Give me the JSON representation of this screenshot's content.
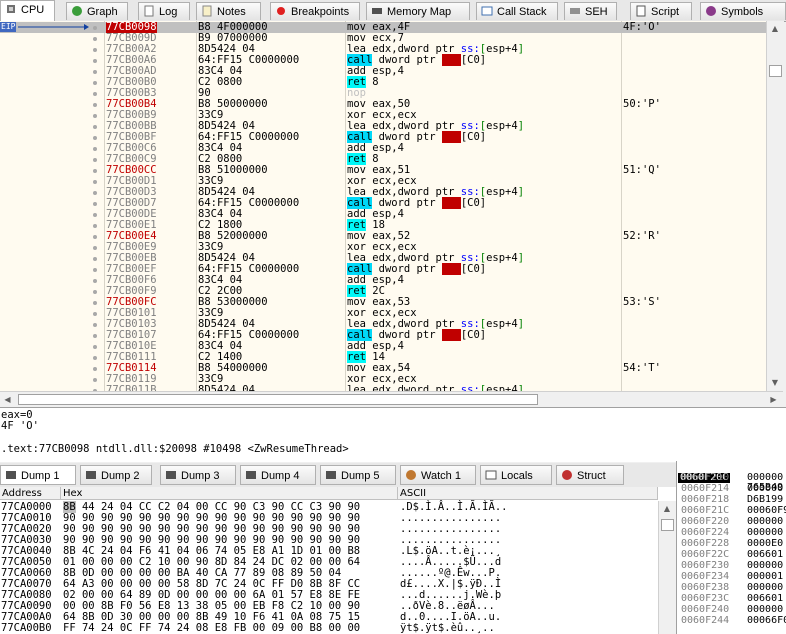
{
  "top_tabs": [
    {
      "label": "CPU",
      "icon": "cpu-icon"
    },
    {
      "label": "Graph",
      "icon": "graph-icon"
    },
    {
      "label": "Log",
      "icon": "log-icon"
    },
    {
      "label": "Notes",
      "icon": "notes-icon"
    },
    {
      "label": "Breakpoints",
      "icon": "breakpoint-icon"
    },
    {
      "label": "Memory Map",
      "icon": "memory-map-icon"
    },
    {
      "label": "Call Stack",
      "icon": "call-stack-icon"
    },
    {
      "label": "SEH",
      "icon": "seh-icon"
    },
    {
      "label": "Script",
      "icon": "script-icon"
    },
    {
      "label": "Symbols",
      "icon": "symbols-icon"
    }
  ],
  "eip_label": "EIP",
  "disasm_rows": [
    {
      "addr": "77CB0098",
      "bytes": "B8 4F000000",
      "instr": "mov eax,4F",
      "comment": "4F:'O'",
      "sel": true
    },
    {
      "addr": "77CB009D",
      "bytes": "B9 07000000",
      "instr": "mov ecx,7"
    },
    {
      "addr": "77CB00A2",
      "bytes": "8D5424 04",
      "instr": "lea edx,dword ptr ss:[esp+4]"
    },
    {
      "addr": "77CB00A6",
      "bytes": "64:FF15 C0000000",
      "instr": "call dword ptr fs:[C0]"
    },
    {
      "addr": "77CB00AD",
      "bytes": "83C4 04",
      "instr": "add esp,4"
    },
    {
      "addr": "77CB00B0",
      "bytes": "C2 0800",
      "instr": "ret 8"
    },
    {
      "addr": "77CB00B3",
      "bytes": "90",
      "instr": "nop"
    },
    {
      "addr": "77CB00B4",
      "bytes": "B8 50000000",
      "instr": "mov eax,50",
      "comment": "50:'P'",
      "red": true
    },
    {
      "addr": "77CB00B9",
      "bytes": "33C9",
      "instr": "xor ecx,ecx"
    },
    {
      "addr": "77CB00BB",
      "bytes": "8D5424 04",
      "instr": "lea edx,dword ptr ss:[esp+4]"
    },
    {
      "addr": "77CB00BF",
      "bytes": "64:FF15 C0000000",
      "instr": "call dword ptr fs:[C0]"
    },
    {
      "addr": "77CB00C6",
      "bytes": "83C4 04",
      "instr": "add esp,4"
    },
    {
      "addr": "77CB00C9",
      "bytes": "C2 0800",
      "instr": "ret 8"
    },
    {
      "addr": "77CB00CC",
      "bytes": "B8 51000000",
      "instr": "mov eax,51",
      "comment": "51:'Q'",
      "red": true
    },
    {
      "addr": "77CB00D1",
      "bytes": "33C9",
      "instr": "xor ecx,ecx"
    },
    {
      "addr": "77CB00D3",
      "bytes": "8D5424 04",
      "instr": "lea edx,dword ptr ss:[esp+4]"
    },
    {
      "addr": "77CB00D7",
      "bytes": "64:FF15 C0000000",
      "instr": "call dword ptr fs:[C0]"
    },
    {
      "addr": "77CB00DE",
      "bytes": "83C4 04",
      "instr": "add esp,4"
    },
    {
      "addr": "77CB00E1",
      "bytes": "C2 1800",
      "instr": "ret 18"
    },
    {
      "addr": "77CB00E4",
      "bytes": "B8 52000000",
      "instr": "mov eax,52",
      "comment": "52:'R'",
      "red": true
    },
    {
      "addr": "77CB00E9",
      "bytes": "33C9",
      "instr": "xor ecx,ecx"
    },
    {
      "addr": "77CB00EB",
      "bytes": "8D5424 04",
      "instr": "lea edx,dword ptr ss:[esp+4]"
    },
    {
      "addr": "77CB00EF",
      "bytes": "64:FF15 C0000000",
      "instr": "call dword ptr fs:[C0]"
    },
    {
      "addr": "77CB00F6",
      "bytes": "83C4 04",
      "instr": "add esp,4"
    },
    {
      "addr": "77CB00F9",
      "bytes": "C2 2C00",
      "instr": "ret 2C"
    },
    {
      "addr": "77CB00FC",
      "bytes": "B8 53000000",
      "instr": "mov eax,53",
      "comment": "53:'S'",
      "red": true
    },
    {
      "addr": "77CB0101",
      "bytes": "33C9",
      "instr": "xor ecx,ecx"
    },
    {
      "addr": "77CB0103",
      "bytes": "8D5424 04",
      "instr": "lea edx,dword ptr ss:[esp+4]"
    },
    {
      "addr": "77CB0107",
      "bytes": "64:FF15 C0000000",
      "instr": "call dword ptr fs:[C0]"
    },
    {
      "addr": "77CB010E",
      "bytes": "83C4 04",
      "instr": "add esp,4"
    },
    {
      "addr": "77CB0111",
      "bytes": "C2 1400",
      "instr": "ret 14"
    },
    {
      "addr": "77CB0114",
      "bytes": "B8 54000000",
      "instr": "mov eax,54",
      "comment": "54:'T'",
      "red": true
    },
    {
      "addr": "77CB0119",
      "bytes": "33C9",
      "instr": "xor ecx,ecx"
    },
    {
      "addr": "77CB011B",
      "bytes": "8D5424 04",
      "instr": "lea edx,dword ptr ss:[esp+4]"
    }
  ],
  "info_lines": [
    "eax=0",
    "4F 'O'",
    "",
    ".text:77CB0098 ntdll.dll:$20098 #10498 <ZwResumeThread>"
  ],
  "bottom_tabs": [
    {
      "label": "Dump 1",
      "icon": "dump-icon"
    },
    {
      "label": "Dump 2",
      "icon": "dump-icon"
    },
    {
      "label": "Dump 3",
      "icon": "dump-icon"
    },
    {
      "label": "Dump 4",
      "icon": "dump-icon"
    },
    {
      "label": "Dump 5",
      "icon": "dump-icon"
    },
    {
      "label": "Watch 1",
      "icon": "watch-icon"
    },
    {
      "label": "Locals",
      "icon": "locals-icon"
    },
    {
      "label": "Struct",
      "icon": "struct-icon"
    }
  ],
  "dump_headers": {
    "address": "Address",
    "hex": "Hex",
    "ascii": "ASCII"
  },
  "dump_rows": [
    {
      "addr": "77CA0000",
      "hex": "8B 44 24 04 CC C2 04 00 CC 90 C3 90 CC C3 90 90",
      "ascii": ".D$.Ì.Â..Ì.Ã.ÌÃ.."
    },
    {
      "addr": "77CA0010",
      "hex": "90 90 90 90 90 90 90 90 90 90 90 90 90 90 90 90",
      "ascii": "................"
    },
    {
      "addr": "77CA0020",
      "hex": "90 90 90 90 90 90 90 90 90 90 90 90 90 90 90 90",
      "ascii": "................"
    },
    {
      "addr": "77CA0030",
      "hex": "90 90 90 90 90 90 90 90 90 90 90 90 90 90 90 90",
      "ascii": "................"
    },
    {
      "addr": "77CA0040",
      "hex": "8B 4C 24 04 F6 41 04 06 74 05 E8 A1 1D 01 00 B8",
      "ascii": ".L$.öA..t.è¡...¸"
    },
    {
      "addr": "77CA0050",
      "hex": "01 00 00 00 C2 10 00 90 8D 84 24 DC 02 00 00 64",
      "ascii": "....Â.....$Ü...d"
    },
    {
      "addr": "77CA0060",
      "hex": "8B 0D 00 00 00 00 BA 40 CA 77 89 08 89 50 04",
      "ascii": "......º@.Êw...P."
    },
    {
      "addr": "77CA0070",
      "hex": "64 A3 00 00 00 00 58 8D 7C 24 0C FF D0 8B 8F CC",
      "ascii": "d£....X.|$.ÿÐ..Ì"
    },
    {
      "addr": "77CA0080",
      "hex": "02 00 00 64 89 0D 00 00 00 00 6A 01 57 E8 8E FE",
      "ascii": "...d......j.Wè.þ"
    },
    {
      "addr": "77CA0090",
      "hex": "00 00 8B F0 56 E8 13 38 05 00 EB F8 C2 10 00 90",
      "ascii": "..ðVè.8..ëøÂ..."
    },
    {
      "addr": "77CA00A0",
      "hex": "64 8B 0D 30 00 00 00 8B 49 10 F6 41 0A 08 75 15",
      "ascii": "d..0....I.öA..u."
    },
    {
      "addr": "77CA00B0",
      "hex": "FF 74 24 0C FF 74 24 08 E8 FB 00 09 00 B8 00 00",
      "ascii": "ÿt$.ÿt$.èû..¸.."
    }
  ],
  "stack_header": {
    "addr": "0060F20C",
    "val": "765B49"
  },
  "stack_rows": [
    {
      "addr": "0060F210",
      "val": "000000"
    },
    {
      "addr": "0060F214",
      "val": "000000"
    },
    {
      "addr": "0060F218",
      "val": "D6B199"
    },
    {
      "addr": "0060F21C",
      "val": "00060F9"
    },
    {
      "addr": "0060F220",
      "val": "000000"
    },
    {
      "addr": "0060F224",
      "val": "000000"
    },
    {
      "addr": "0060F228",
      "val": "0000E0"
    },
    {
      "addr": "0060F22C",
      "val": "006601"
    },
    {
      "addr": "0060F230",
      "val": "000000"
    },
    {
      "addr": "0060F234",
      "val": "000001"
    },
    {
      "addr": "0060F238",
      "val": "000000"
    },
    {
      "addr": "0060F23C",
      "val": "006601"
    },
    {
      "addr": "0060F240",
      "val": "000000"
    },
    {
      "addr": "0060F244",
      "val": "00066F0"
    }
  ]
}
